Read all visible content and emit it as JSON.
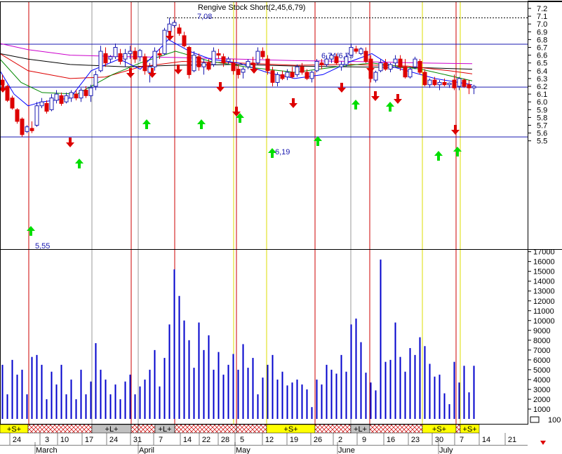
{
  "chart_data": {
    "type": "candlestick",
    "title": "Rengive Stock Short(2,45,6,79)",
    "price_ticks": [
      "7.2",
      "7.1",
      "7.0",
      "6.9",
      "6.8",
      "6.7",
      "6.6",
      "6.5",
      "6.4",
      "6.3",
      "6.2",
      "6.1",
      "6.0",
      "5.9",
      "5.8",
      "5.7",
      "5.6",
      "5.5"
    ],
    "price_range": [
      5.5,
      7.2
    ],
    "volume_ticks": [
      "17000",
      "16000",
      "15000",
      "14000",
      "13000",
      "12000",
      "11000",
      "10000",
      "9000",
      "8000",
      "7000",
      "6000",
      "5000",
      "4000",
      "3000",
      "2000",
      "1000"
    ],
    "volume_range": [
      0,
      17500
    ],
    "date_ticks": [
      "24",
      "3",
      "10",
      "17",
      "24",
      "31",
      "7",
      "14",
      "22",
      "28",
      "5",
      "12",
      "19",
      "26",
      "2",
      "9",
      "16",
      "23",
      "30",
      "7",
      "14",
      "21"
    ],
    "month_labels": [
      "March",
      "April",
      "May",
      "June",
      "July"
    ],
    "levels": [
      {
        "value": 7.08,
        "label": "7,08",
        "style": "dotted"
      },
      {
        "value": 6.74,
        "label": "6,74/6,75",
        "style": "solid"
      },
      {
        "value": 6.19,
        "label": "6,19",
        "style": "solid"
      },
      {
        "value": 5.55,
        "label": "5,55",
        "style": "solid"
      }
    ],
    "signal_labels": [
      "+S+",
      "+L+",
      "+L+",
      "+S+",
      "+L+",
      "+S+",
      "+S+"
    ],
    "volume_axis_label": "100",
    "candles": [
      {
        "o": 6.28,
        "h": 6.35,
        "l": 6.2,
        "c": 6.22
      },
      {
        "o": 6.2,
        "h": 6.22,
        "l": 6.0,
        "c": 6.02
      },
      {
        "o": 6.05,
        "h": 6.08,
        "l": 5.9,
        "c": 5.92
      },
      {
        "o": 5.9,
        "h": 5.92,
        "l": 5.72,
        "c": 5.75
      },
      {
        "o": 5.78,
        "h": 5.8,
        "l": 5.55,
        "c": 5.58
      },
      {
        "o": 5.62,
        "h": 5.7,
        "l": 5.6,
        "c": 5.68
      },
      {
        "o": 5.66,
        "h": 5.75,
        "l": 5.6,
        "c": 5.63
      },
      {
        "o": 5.7,
        "h": 6.0,
        "l": 5.68,
        "c": 5.95
      },
      {
        "o": 5.95,
        "h": 6.05,
        "l": 5.92,
        "c": 6.0
      },
      {
        "o": 5.98,
        "h": 6.02,
        "l": 5.85,
        "c": 5.88
      },
      {
        "o": 5.9,
        "h": 6.1,
        "l": 5.88,
        "c": 6.05
      },
      {
        "o": 6.02,
        "h": 6.15,
        "l": 5.98,
        "c": 6.1
      },
      {
        "o": 6.08,
        "h": 6.12,
        "l": 5.95,
        "c": 5.98
      },
      {
        "o": 6.0,
        "h": 6.12,
        "l": 5.98,
        "c": 6.08
      },
      {
        "o": 6.05,
        "h": 6.15,
        "l": 6.0,
        "c": 6.12
      },
      {
        "o": 6.1,
        "h": 6.15,
        "l": 6.02,
        "c": 6.05
      },
      {
        "o": 6.05,
        "h": 6.18,
        "l": 6.0,
        "c": 6.15
      },
      {
        "o": 6.15,
        "h": 6.2,
        "l": 6.05,
        "c": 6.08
      },
      {
        "o": 6.08,
        "h": 6.22,
        "l": 6.0,
        "c": 6.18
      },
      {
        "o": 6.2,
        "h": 6.4,
        "l": 6.15,
        "c": 6.35
      },
      {
        "o": 6.4,
        "h": 6.72,
        "l": 6.38,
        "c": 6.65
      },
      {
        "o": 6.62,
        "h": 6.7,
        "l": 6.45,
        "c": 6.5
      },
      {
        "o": 6.55,
        "h": 6.6,
        "l": 6.5,
        "c": 6.58
      },
      {
        "o": 6.58,
        "h": 6.75,
        "l": 6.55,
        "c": 6.7
      },
      {
        "o": 6.62,
        "h": 6.68,
        "l": 6.48,
        "c": 6.52
      },
      {
        "o": 6.55,
        "h": 6.68,
        "l": 6.45,
        "c": 6.62
      },
      {
        "o": 6.62,
        "h": 6.72,
        "l": 6.55,
        "c": 6.65
      },
      {
        "o": 6.65,
        "h": 6.7,
        "l": 6.5,
        "c": 6.55
      },
      {
        "o": 6.58,
        "h": 6.68,
        "l": 6.52,
        "c": 6.66
      },
      {
        "o": 6.58,
        "h": 6.62,
        "l": 6.35,
        "c": 6.4
      },
      {
        "o": 6.38,
        "h": 6.5,
        "l": 6.25,
        "c": 6.45
      },
      {
        "o": 6.45,
        "h": 6.7,
        "l": 6.4,
        "c": 6.65
      },
      {
        "o": 6.62,
        "h": 6.68,
        "l": 6.55,
        "c": 6.6
      },
      {
        "o": 6.62,
        "h": 6.95,
        "l": 6.6,
        "c": 6.92
      },
      {
        "o": 6.9,
        "h": 7.08,
        "l": 6.85,
        "c": 7.0
      },
      {
        "o": 6.98,
        "h": 7.05,
        "l": 6.95,
        "c": 7.02
      },
      {
        "o": 6.95,
        "h": 7.0,
        "l": 6.85,
        "c": 6.88
      },
      {
        "o": 6.85,
        "h": 6.9,
        "l": 6.7,
        "c": 6.72
      },
      {
        "o": 6.7,
        "h": 6.72,
        "l": 6.3,
        "c": 6.35
      },
      {
        "o": 6.4,
        "h": 6.65,
        "l": 6.38,
        "c": 6.6
      },
      {
        "o": 6.58,
        "h": 6.62,
        "l": 6.4,
        "c": 6.45
      },
      {
        "o": 6.45,
        "h": 6.55,
        "l": 6.35,
        "c": 6.5
      },
      {
        "o": 6.5,
        "h": 6.55,
        "l": 6.4,
        "c": 6.42
      },
      {
        "o": 6.48,
        "h": 6.7,
        "l": 6.45,
        "c": 6.65
      },
      {
        "o": 6.62,
        "h": 6.68,
        "l": 6.55,
        "c": 6.6
      },
      {
        "o": 6.58,
        "h": 6.62,
        "l": 6.45,
        "c": 6.5
      },
      {
        "o": 6.52,
        "h": 6.58,
        "l": 6.48,
        "c": 6.55
      },
      {
        "o": 6.5,
        "h": 6.55,
        "l": 6.35,
        "c": 6.4
      },
      {
        "o": 6.42,
        "h": 6.48,
        "l": 6.3,
        "c": 6.35
      },
      {
        "o": 6.38,
        "h": 6.45,
        "l": 6.3,
        "c": 6.42
      },
      {
        "o": 6.45,
        "h": 6.55,
        "l": 6.42,
        "c": 6.52
      },
      {
        "o": 6.5,
        "h": 6.58,
        "l": 6.45,
        "c": 6.48
      },
      {
        "o": 6.5,
        "h": 6.7,
        "l": 6.48,
        "c": 6.65
      },
      {
        "o": 6.65,
        "h": 6.7,
        "l": 6.55,
        "c": 6.58
      },
      {
        "o": 6.55,
        "h": 6.6,
        "l": 6.35,
        "c": 6.4
      },
      {
        "o": 6.4,
        "h": 6.45,
        "l": 6.2,
        "c": 6.25
      },
      {
        "o": 6.25,
        "h": 6.38,
        "l": 6.2,
        "c": 6.35
      },
      {
        "o": 6.35,
        "h": 6.4,
        "l": 6.28,
        "c": 6.3
      },
      {
        "o": 6.32,
        "h": 6.42,
        "l": 6.28,
        "c": 6.38
      },
      {
        "o": 6.38,
        "h": 6.45,
        "l": 6.3,
        "c": 6.32
      },
      {
        "o": 6.35,
        "h": 6.48,
        "l": 6.32,
        "c": 6.45
      },
      {
        "o": 6.45,
        "h": 6.5,
        "l": 6.35,
        "c": 6.38
      },
      {
        "o": 6.38,
        "h": 6.42,
        "l": 6.28,
        "c": 6.3
      },
      {
        "o": 6.3,
        "h": 6.4,
        "l": 6.25,
        "c": 6.38
      },
      {
        "o": 6.4,
        "h": 6.55,
        "l": 6.38,
        "c": 6.52
      },
      {
        "o": 6.5,
        "h": 6.55,
        "l": 6.42,
        "c": 6.48
      },
      {
        "o": 6.48,
        "h": 6.6,
        "l": 6.45,
        "c": 6.55
      },
      {
        "o": 6.55,
        "h": 6.62,
        "l": 6.5,
        "c": 6.6
      },
      {
        "o": 6.58,
        "h": 6.62,
        "l": 6.48,
        "c": 6.5
      },
      {
        "o": 6.45,
        "h": 6.52,
        "l": 6.4,
        "c": 6.48
      },
      {
        "o": 6.48,
        "h": 6.62,
        "l": 6.45,
        "c": 6.58
      },
      {
        "o": 6.6,
        "h": 6.75,
        "l": 6.58,
        "c": 6.7
      },
      {
        "o": 6.68,
        "h": 6.72,
        "l": 6.62,
        "c": 6.65
      },
      {
        "o": 6.62,
        "h": 6.7,
        "l": 6.6,
        "c": 6.68
      },
      {
        "o": 6.65,
        "h": 6.7,
        "l": 6.5,
        "c": 6.52
      },
      {
        "o": 6.55,
        "h": 6.6,
        "l": 6.25,
        "c": 6.3
      },
      {
        "o": 6.28,
        "h": 6.4,
        "l": 6.25,
        "c": 6.38
      },
      {
        "o": 6.4,
        "h": 6.55,
        "l": 6.38,
        "c": 6.5
      },
      {
        "o": 6.5,
        "h": 6.55,
        "l": 6.4,
        "c": 6.42
      },
      {
        "o": 6.42,
        "h": 6.5,
        "l": 6.38,
        "c": 6.48
      },
      {
        "o": 6.5,
        "h": 6.6,
        "l": 6.45,
        "c": 6.55
      },
      {
        "o": 6.55,
        "h": 6.6,
        "l": 6.4,
        "c": 6.45
      },
      {
        "o": 6.45,
        "h": 6.55,
        "l": 6.3,
        "c": 6.32
      },
      {
        "o": 6.32,
        "h": 6.45,
        "l": 6.3,
        "c": 6.42
      },
      {
        "o": 6.45,
        "h": 6.58,
        "l": 6.42,
        "c": 6.55
      },
      {
        "o": 6.52,
        "h": 6.55,
        "l": 6.35,
        "c": 6.38
      },
      {
        "o": 6.38,
        "h": 6.42,
        "l": 6.2,
        "c": 6.22
      },
      {
        "o": 6.22,
        "h": 6.3,
        "l": 6.18,
        "c": 6.28
      },
      {
        "o": 6.28,
        "h": 6.32,
        "l": 6.2,
        "c": 6.22
      },
      {
        "o": 6.22,
        "h": 6.28,
        "l": 6.15,
        "c": 6.25
      },
      {
        "o": 6.25,
        "h": 6.3,
        "l": 6.2,
        "c": 6.22
      },
      {
        "o": 6.22,
        "h": 6.25,
        "l": 6.18,
        "c": 6.24
      },
      {
        "o": 6.28,
        "h": 6.35,
        "l": 6.15,
        "c": 6.18
      },
      {
        "o": 6.2,
        "h": 6.32,
        "l": 6.15,
        "c": 6.3
      },
      {
        "o": 6.28,
        "h": 6.3,
        "l": 6.18,
        "c": 6.2
      },
      {
        "o": 6.22,
        "h": 6.28,
        "l": 6.1,
        "c": 6.18
      },
      {
        "o": 6.18,
        "h": 6.22,
        "l": 6.1,
        "c": 6.2
      }
    ],
    "volumes": [
      5500,
      2500,
      6000,
      4500,
      5000,
      2500,
      6300,
      6500,
      5500,
      2000,
      4800,
      3500,
      5500,
      2500,
      4000,
      2000,
      5000,
      2500,
      3800,
      7700,
      5000,
      4000,
      2500,
      3500,
      2000,
      3800,
      4500,
      2500,
      3300,
      4000,
      5000,
      7000,
      3300,
      6200,
      9600,
      15200,
      12500,
      10000,
      8000,
      5200,
      9800,
      7000,
      8500,
      5000,
      6800,
      4500,
      5500,
      6600,
      5000,
      7600,
      5200,
      6200,
      2500,
      4200,
      5500,
      6500,
      4000,
      4800,
      3400,
      3700,
      4000,
      3500,
      3000,
      1200,
      4000,
      3500,
      5500,
      5000,
      4600,
      6500,
      4800,
      9600,
      10200,
      7800,
      4700,
      3700,
      2900,
      16200,
      5800,
      6000,
      9800,
      6300,
      4800,
      7200,
      6500,
      8300,
      7400,
      5600,
      4300,
      4500,
      2600,
      1500,
      5800,
      3700,
      5400,
      2700,
      5400
    ],
    "moving_averages": [
      {
        "color": "#cc00cc",
        "values": [
          [
            0,
            6.75
          ],
          [
            40,
            6.67
          ],
          [
            100,
            6.6
          ],
          [
            180,
            6.58
          ],
          [
            250,
            6.57
          ],
          [
            340,
            6.55
          ],
          [
            420,
            6.53
          ],
          [
            500,
            6.52
          ],
          [
            600,
            6.5
          ],
          [
            673,
            6.49
          ]
        ]
      },
      {
        "color": "#000000",
        "values": [
          [
            0,
            6.62
          ],
          [
            40,
            6.55
          ],
          [
            100,
            6.48
          ],
          [
            180,
            6.45
          ],
          [
            250,
            6.47
          ],
          [
            340,
            6.48
          ],
          [
            420,
            6.46
          ],
          [
            500,
            6.45
          ],
          [
            600,
            6.44
          ],
          [
            673,
            6.42
          ]
        ]
      },
      {
        "color": "#dd0000",
        "values": [
          [
            0,
            6.62
          ],
          [
            40,
            6.4
          ],
          [
            100,
            6.3
          ],
          [
            150,
            6.32
          ],
          [
            200,
            6.45
          ],
          [
            260,
            6.52
          ],
          [
            340,
            6.5
          ],
          [
            420,
            6.47
          ],
          [
            500,
            6.48
          ],
          [
            580,
            6.46
          ],
          [
            640,
            6.4
          ],
          [
            673,
            6.36
          ]
        ]
      },
      {
        "color": "#008800",
        "values": [
          [
            0,
            6.55
          ],
          [
            30,
            6.25
          ],
          [
            60,
            6.12
          ],
          [
            110,
            6.1
          ],
          [
            160,
            6.35
          ],
          [
            200,
            6.5
          ],
          [
            250,
            6.65
          ],
          [
            300,
            6.52
          ],
          [
            350,
            6.45
          ],
          [
            420,
            6.38
          ],
          [
            480,
            6.45
          ],
          [
            530,
            6.5
          ],
          [
            600,
            6.42
          ],
          [
            673,
            6.27
          ]
        ]
      },
      {
        "color": "#0000ff",
        "values": [
          [
            0,
            6.4
          ],
          [
            20,
            6.1
          ],
          [
            40,
            5.95
          ],
          [
            60,
            6.0
          ],
          [
            100,
            6.05
          ],
          [
            130,
            6.4
          ],
          [
            170,
            6.55
          ],
          [
            200,
            6.42
          ],
          [
            240,
            6.8
          ],
          [
            270,
            6.65
          ],
          [
            300,
            6.55
          ],
          [
            340,
            6.5
          ],
          [
            380,
            6.38
          ],
          [
            420,
            6.3
          ],
          [
            460,
            6.35
          ],
          [
            500,
            6.52
          ],
          [
            530,
            6.62
          ],
          [
            560,
            6.45
          ],
          [
            620,
            6.3
          ],
          [
            673,
            6.22
          ]
        ]
      }
    ]
  }
}
